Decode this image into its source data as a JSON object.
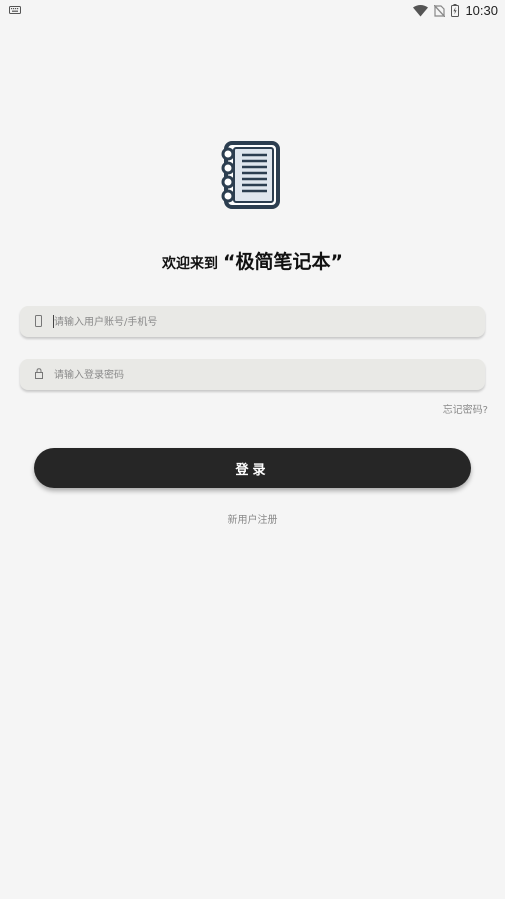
{
  "status_bar": {
    "time": "10:30",
    "icons": [
      "keyboard-icon",
      "wifi-icon",
      "no-sim-icon",
      "battery-charging-icon"
    ]
  },
  "logo": {
    "icon": "notebook-icon",
    "color": "#2c3e50"
  },
  "welcome": {
    "prefix": "欢迎来到",
    "app_name": "“极简笔记本”"
  },
  "form": {
    "account_placeholder": "请输入用户账号/手机号",
    "password_placeholder": "请输入登录密码",
    "forgot_label": "忘记密码?",
    "login_label": "登录",
    "register_label": "新用户注册"
  },
  "colors": {
    "background": "#f5f5f5",
    "input_bg": "#e9e9e6",
    "button_bg": "#262626",
    "muted_text": "#8a8a8a"
  }
}
